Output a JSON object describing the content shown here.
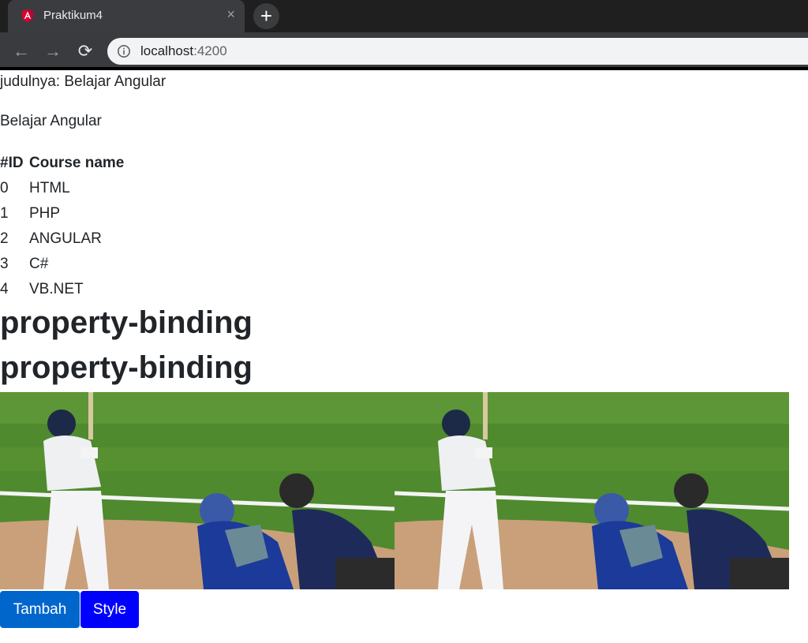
{
  "browser": {
    "tab_title": "Praktikum4",
    "close_glyph": "×",
    "new_tab_glyph": "+",
    "back_glyph": "←",
    "forward_glyph": "→",
    "reload_glyph": "⟳",
    "url_host": "localhost",
    "url_port": ":4200"
  },
  "content": {
    "judul_line": "judulnya: Belajar Angular",
    "subtitle": "Belajar Angular",
    "table": {
      "headers": [
        "#ID",
        "Course name"
      ],
      "rows": [
        [
          "0",
          "HTML"
        ],
        [
          "1",
          "PHP"
        ],
        [
          "2",
          "ANGULAR"
        ],
        [
          "3",
          "C#"
        ],
        [
          "4",
          "VB.NET"
        ]
      ]
    },
    "heading_1": "property-binding",
    "heading_2": "property-binding",
    "buttons": {
      "tambah": "Tambah",
      "style": "Style"
    }
  },
  "icons": {
    "favicon": "angular-icon",
    "info": "info-icon"
  },
  "colors": {
    "tambah_button": "#0066cc",
    "style_button": "#0000ff",
    "angular_red": "#dd0031"
  }
}
